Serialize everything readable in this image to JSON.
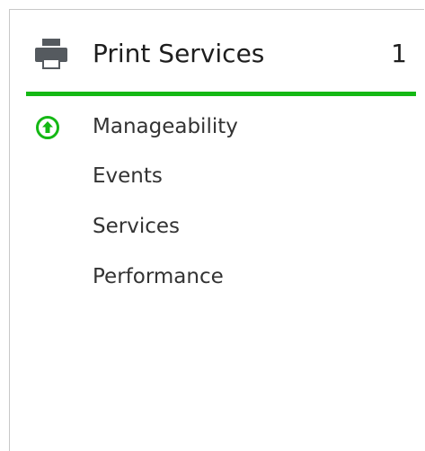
{
  "tile": {
    "title": "Print Services",
    "count": "1",
    "icon": "printer-icon",
    "status_color": "#14b814"
  },
  "items": [
    {
      "label": "Manageability",
      "icon": "arrow-up-circle-icon"
    },
    {
      "label": "Events"
    },
    {
      "label": "Services"
    },
    {
      "label": "Performance"
    }
  ]
}
